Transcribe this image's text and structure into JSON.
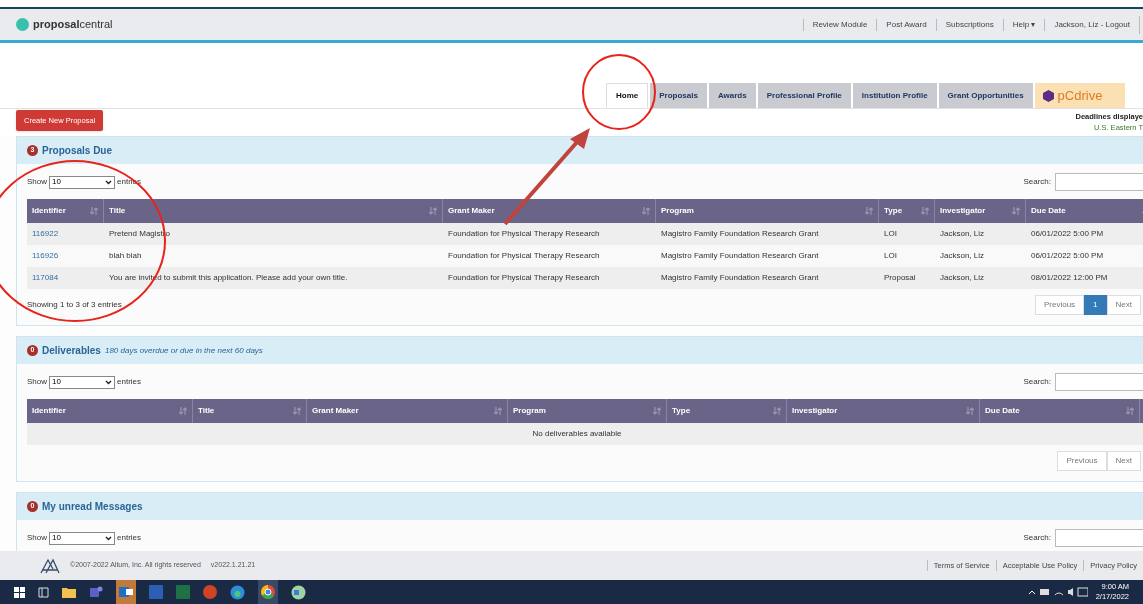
{
  "header": {
    "logo": {
      "bold": "proposal",
      "light": "central"
    },
    "nav": [
      "Review Module",
      "Post Award",
      "Subscriptions",
      "Help ▾",
      "Jackson, Liz - Logout"
    ]
  },
  "tabs": [
    {
      "label": "Home",
      "selected": true
    },
    {
      "label": "Proposals",
      "selected": false
    },
    {
      "label": "Awards",
      "selected": false
    },
    {
      "label": "Professional Profile",
      "selected": false
    },
    {
      "label": "Institution Profile",
      "selected": false
    },
    {
      "label": "Grant Opportunities",
      "selected": false
    }
  ],
  "pcdrive": "pCdrive",
  "create_button": "Create New Proposal",
  "deadlines": {
    "line1": "Deadlines displaye",
    "line2": "U.S. Eastern T"
  },
  "panels": [
    {
      "badge": "3",
      "title": "Proposals Due",
      "show_label": "Show",
      "page_size": "10",
      "entries_label": "entries",
      "search_label": "Search:",
      "columns": [
        "Identifier",
        "Title",
        "Grant Maker",
        "Program",
        "Type",
        "Investigator",
        "Due Date"
      ],
      "rows": [
        [
          "116922",
          "Pretend Magistro",
          "Foundation for Physical Therapy Research",
          "Magistro Family Foundation Research Grant",
          "LOI",
          "Jackson, Liz",
          "06/01/2022 5:00 PM"
        ],
        [
          "116926",
          "blah blah",
          "Foundation for Physical Therapy Research",
          "Magistro Family Foundation Research Grant",
          "LOI",
          "Jackson, Liz",
          "06/01/2022 5:00 PM"
        ],
        [
          "117084",
          "You are invited to submit this application. Please add your own title.",
          "Foundation for Physical Therapy Research",
          "Magistro Family Foundation Research Grant",
          "Proposal",
          "Jackson, Liz",
          "08/01/2022 12:00 PM"
        ]
      ],
      "info": "Showing 1 to 3 of 3 entries",
      "pagination": [
        {
          "label": "Previous",
          "selected": false
        },
        {
          "label": "1",
          "selected": true
        },
        {
          "label": "Next",
          "selected": false
        }
      ]
    },
    {
      "badge": "0",
      "title": "Deliverables",
      "subtitle": "180 days overdue or due in the next 60 days",
      "show_label": "Show",
      "page_size": "10",
      "entries_label": "entries",
      "search_label": "Search:",
      "columns": [
        "Identifier",
        "Title",
        "Grant Maker",
        "Program",
        "Type",
        "Investigator",
        "Due Date"
      ],
      "empty_message": "No deliverables available",
      "pagination": [
        {
          "label": "Previous",
          "selected": false
        },
        {
          "label": "Next",
          "selected": false
        }
      ]
    },
    {
      "badge": "0",
      "title": "My unread Messages",
      "show_label": "Show",
      "page_size": "10",
      "entries_label": "entries",
      "search_label": "Search:"
    }
  ],
  "footer": {
    "copyright": "©2007-2022 Altum, Inc. All rights reserved",
    "version": "v2022.1.21.21",
    "links": [
      "Terms of Service",
      "Acceptable Use Policy",
      "Privacy Policy"
    ]
  },
  "taskbar": {
    "time": "9:00 AM",
    "date": "2/17/2022"
  }
}
